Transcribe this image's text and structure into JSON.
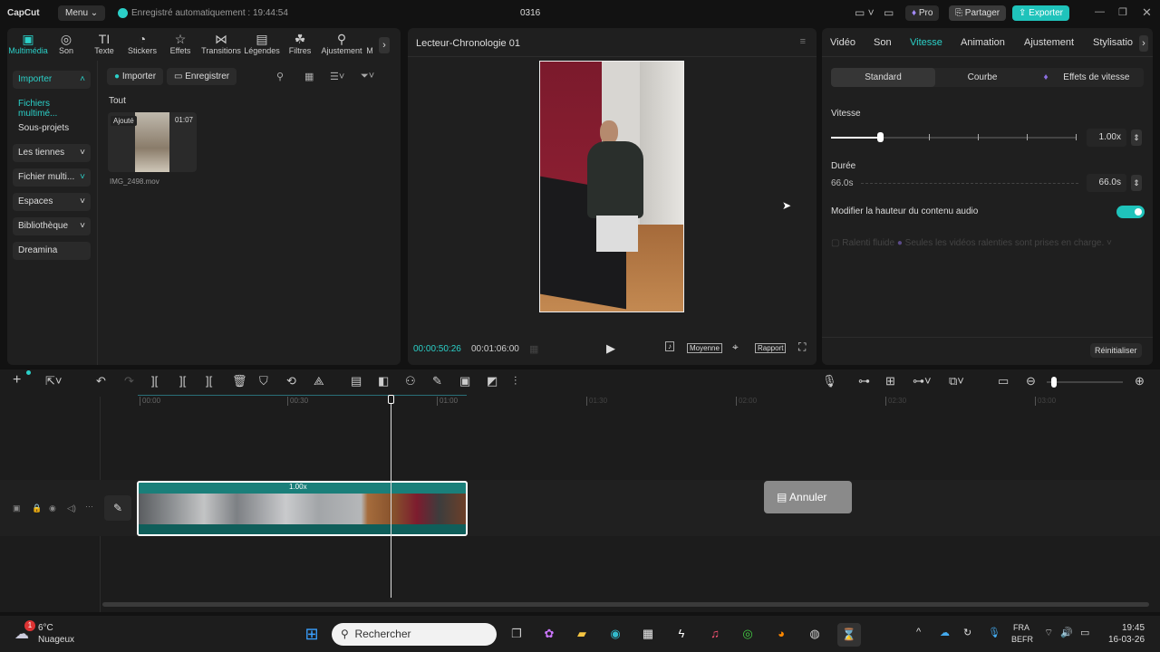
{
  "app": {
    "logo": "CapCut",
    "menu": "Menu",
    "autosave": "Enregistré automatiquement : 19:44:54",
    "project": "0316",
    "pro": "Pro",
    "share": "Partager",
    "export": "Exporter"
  },
  "media_tabs": [
    "Multimédia",
    "Son",
    "Texte",
    "Stickers",
    "Effets",
    "Transitions",
    "Légendes",
    "Filtres",
    "Ajustement",
    "M"
  ],
  "media_tab_icons": [
    "play-icon",
    "music-icon",
    "text-icon",
    "sticker-icon",
    "effects-icon",
    "transitions-icon",
    "captions-icon",
    "filters-icon",
    "adjust-icon"
  ],
  "sidebar": [
    {
      "label": "Importer",
      "active": true
    },
    {
      "label": "Fichiers multimé..."
    },
    {
      "label": "Sous-projets"
    },
    {
      "label": "Les tiennes"
    },
    {
      "label": "Fichier multi..."
    },
    {
      "label": "Espaces"
    },
    {
      "label": "Bibliothèque"
    },
    {
      "label": "Dreamina"
    }
  ],
  "media": {
    "import": "Importer",
    "record": "Enregistrer",
    "filter_all": "Tout",
    "clip": {
      "badge": "Ajouté",
      "duration": "01:07",
      "name": "IMG_2498.mov"
    }
  },
  "player": {
    "title": "Lecteur-Chronologie 01",
    "current": "00:00:50:26",
    "total": "00:01:06:00",
    "quality": "Moyenne",
    "ratio": "Rapport"
  },
  "inspector": {
    "tabs": [
      "Vidéo",
      "Son",
      "Vitesse",
      "Animation",
      "Ajustement",
      "Stylisatio"
    ],
    "active_tab": "Vitesse",
    "subtabs": [
      "Standard",
      "Courbe",
      "Effets de vitesse"
    ],
    "speed_label": "Vitesse",
    "speed_value": "1.00x",
    "speed_fraction": 0.2,
    "duration_label": "Durée",
    "duration_from": "66.0s",
    "duration_value": "66.0s",
    "pitch_label": "Modifier la hauteur du contenu audio",
    "pitch_on": true,
    "smooth_label": "Ralenti fluide",
    "smooth_note": "Seules les vidéos ralenties sont prises en charge.",
    "reset": "Réinitialiser"
  },
  "timeline": {
    "ticks": [
      "00:00",
      "00:30",
      "01:00",
      "01:30",
      "02:00",
      "02:30",
      "03:00"
    ],
    "clip_speed": "1.00x",
    "undo_toast": "Annuler"
  },
  "taskbar": {
    "temp": "6°C",
    "weather": "Nuageux",
    "weather_badge": "1",
    "search": "Rechercher",
    "lang1": "FRA",
    "lang2": "BEFR",
    "time": "19:45",
    "date": "16-03-26"
  },
  "colors": {
    "accent": "#2bd0c8"
  }
}
